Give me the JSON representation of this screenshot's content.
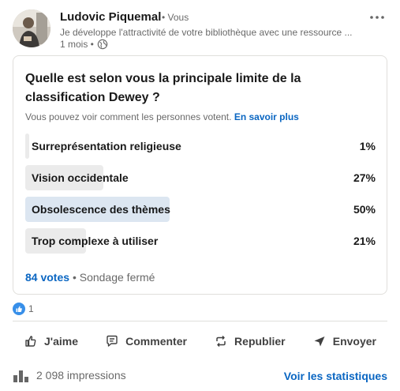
{
  "post": {
    "author_name": "Ludovic Piquemal",
    "author_degree": "• Vous",
    "headline": "Je développe l'attractivité de votre bibliothèque avec une ressource ...",
    "timestamp": "1 mois •",
    "visibility_icon": "globe-icon",
    "more_icon": "ellipsis-icon"
  },
  "poll": {
    "question": "Quelle est selon vous la principale limite de la classification Dewey ?",
    "note": "Vous pouvez voir comment les personnes votent.",
    "learn_more": "En savoir plus",
    "options": [
      {
        "label": "Surreprésentation religieuse",
        "percent_label": "1%",
        "share": 0.01,
        "selected": false
      },
      {
        "label": "Vision occidentale",
        "percent_label": "27%",
        "share": 0.27,
        "selected": false
      },
      {
        "label": "Obsolescence des thèmes",
        "percent_label": "50%",
        "share": 0.5,
        "selected": true
      },
      {
        "label": "Trop complexe à utiliser",
        "percent_label": "21%",
        "share": 0.21,
        "selected": false
      }
    ],
    "votes": "84 votes",
    "status": "• Sondage fermé"
  },
  "reactions": {
    "count": "1",
    "icon": "like-reaction-icon"
  },
  "actions": {
    "like": "J'aime",
    "comment": "Commenter",
    "repost": "Republier",
    "send": "Envoyer"
  },
  "footer": {
    "impressions": "2 098 impressions",
    "stats_link": "Voir les statistiques"
  },
  "colors": {
    "link": "#0a66c2",
    "bar": "#ebebeb",
    "bar_selected": "#dce6f1"
  }
}
